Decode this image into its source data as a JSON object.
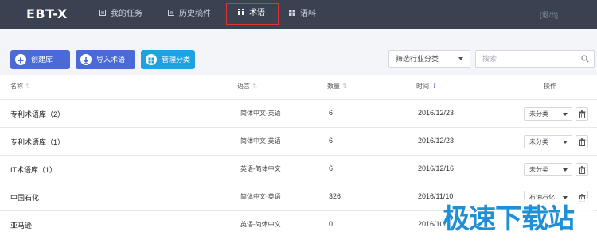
{
  "app": {
    "logo": "EBT-X",
    "logout": "[退出]"
  },
  "nav": {
    "items": [
      {
        "label": "我的任务",
        "icon": "task-icon"
      },
      {
        "label": "历史稿件",
        "icon": "history-icon"
      },
      {
        "label": "术语",
        "icon": "term-icon",
        "active": true
      },
      {
        "label": "语料",
        "icon": "corpus-icon"
      }
    ]
  },
  "toolbar": {
    "create_label": "创建库",
    "import_label": "导入术语",
    "manage_label": "管理分类",
    "filter_label": "筛选行业分类",
    "search_placeholder": "搜索"
  },
  "table": {
    "headers": {
      "name": "名称",
      "language": "语言",
      "count": "数量",
      "time": "时间",
      "action": "操作"
    },
    "rows": [
      {
        "name": "专利术语库（2）",
        "language": "简体中文-英语",
        "count": "6",
        "time": "2016/12/23",
        "category": "未分类"
      },
      {
        "name": "专利术语库（1）",
        "language": "简体中文-英语",
        "count": "6",
        "time": "2016/12/23",
        "category": "未分类"
      },
      {
        "name": "IT术语库（1）",
        "language": "英语-简体中文",
        "count": "6",
        "time": "2016/12/16",
        "category": "未分类"
      },
      {
        "name": "中国石化",
        "language": "简体中文-英语",
        "count": "326",
        "time": "2016/11/10",
        "category": "石油石化"
      },
      {
        "name": "亚马逊",
        "language": "英语-简体中文",
        "count": "0",
        "time": "2016/10/1",
        "category": ""
      }
    ]
  },
  "watermark": {
    "text": "极速下载站"
  },
  "colors": {
    "topbar": "#3a4150",
    "primary_button": "#4a6ad6",
    "manage_button": "#1fa2e0",
    "active_nav_border": "#e0322f",
    "watermark": "#1f8fd6"
  }
}
